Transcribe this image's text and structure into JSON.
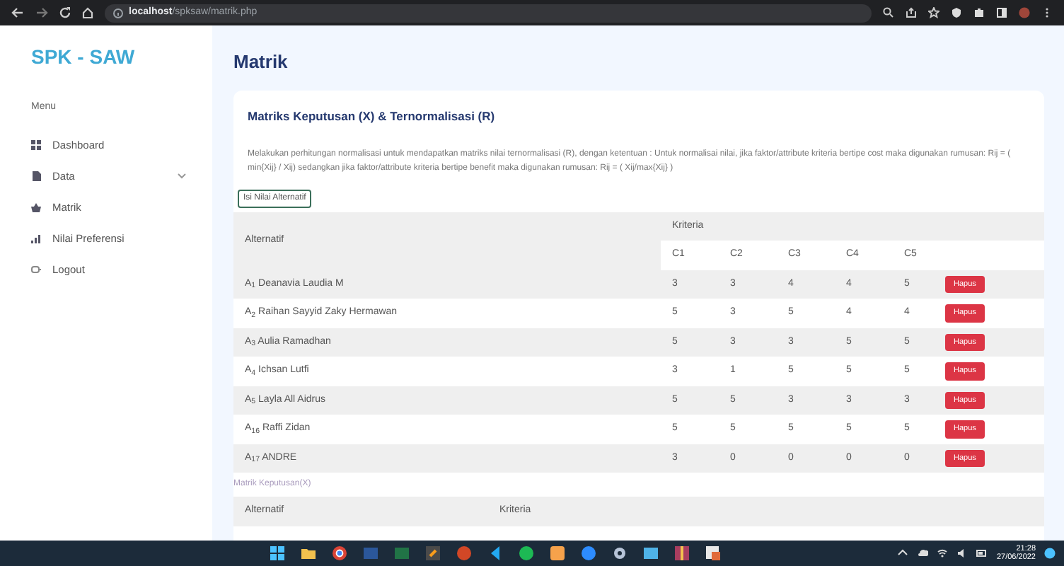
{
  "browser": {
    "url_host": "localhost",
    "url_path": "/spksaw/matrik.php"
  },
  "sidebar": {
    "logo": "SPK - SAW",
    "menu_label": "Menu",
    "items": [
      {
        "label": "Dashboard",
        "has_submenu": false
      },
      {
        "label": "Data",
        "has_submenu": true
      },
      {
        "label": "Matrik",
        "has_submenu": false
      },
      {
        "label": "Nilai Preferensi",
        "has_submenu": false
      },
      {
        "label": "Logout",
        "has_submenu": false
      }
    ]
  },
  "page_title": "Matrik",
  "card": {
    "title": "Matriks Keputusan (X) & Ternormalisasi (R)",
    "description": "Melakukan perhitungan normalisasi untuk mendapatkan matriks nilai ternormalisasi (R), dengan ketentuan : Untuk normalisai nilai, jika faktor/attribute kriteria bertipe cost maka digunakan rumusan: Rij = ( min{Xij} / Xij) sedangkan jika faktor/attribute kriteria bertipe benefit maka digunakan rumusan: Rij = ( Xij/max{Xij} )",
    "button": "Isi Nilai Alternatif",
    "table": {
      "col_alternatif": "Alternatif",
      "col_kriteria": "Kriteria",
      "criteria": [
        "C1",
        "C2",
        "C3",
        "C4",
        "C5"
      ],
      "rows": [
        {
          "name": "A$_{1}$ Deanavia Laudia M",
          "values": [
            "3",
            "3",
            "4",
            "4",
            "5"
          ],
          "action": "Hapus"
        },
        {
          "name": "A$_{2}$ Raihan Sayyid Zaky Hermawan",
          "values": [
            "5",
            "3",
            "5",
            "4",
            "4"
          ],
          "action": "Hapus"
        },
        {
          "name": "A$_{3}$ Aulia Ramadhan",
          "values": [
            "5",
            "3",
            "3",
            "5",
            "5"
          ],
          "action": "Hapus"
        },
        {
          "name": "A$_{4}$ Ichsan Lutfi",
          "values": [
            "3",
            "1",
            "5",
            "5",
            "5"
          ],
          "action": "Hapus"
        },
        {
          "name": "A$_{5}$ Layla All Aidrus",
          "values": [
            "5",
            "5",
            "3",
            "3",
            "3"
          ],
          "action": "Hapus"
        },
        {
          "name": "A$_{16}$ Raffi Zidan",
          "values": [
            "5",
            "5",
            "5",
            "5",
            "5"
          ],
          "action": "Hapus"
        },
        {
          "name": "A$_{17}$ ANDRE",
          "values": [
            "3",
            "0",
            "0",
            "0",
            "0"
          ],
          "action": "Hapus"
        }
      ]
    },
    "section_label": "Matrik Keputusan(X)",
    "table2": {
      "col_alternatif": "Alternatif",
      "col_kriteria": "Kriteria"
    }
  },
  "taskbar": {
    "time": "21:28",
    "date": "27/06/2022"
  }
}
